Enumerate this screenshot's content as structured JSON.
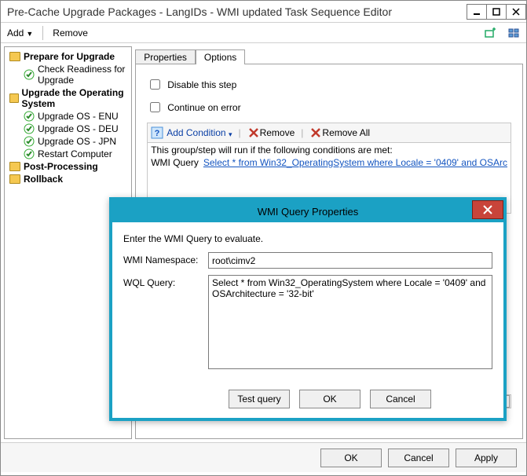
{
  "window": {
    "title": "Pre-Cache Upgrade Packages - LangIDs - WMI updated Task Sequence Editor"
  },
  "toolbar": {
    "add": "Add",
    "remove": "Remove"
  },
  "tree": {
    "g1": "Prepare for Upgrade",
    "g1a": "Check Readiness for Upgrade",
    "g2": "Upgrade the Operating System",
    "g2a": "Upgrade OS - ENU",
    "g2b": "Upgrade OS - DEU",
    "g2c": "Upgrade OS - JPN",
    "g2d": "Restart Computer",
    "g3": "Post-Processing",
    "g4": "Rollback"
  },
  "tabs": {
    "properties": "Properties",
    "options": "Options"
  },
  "options": {
    "disable": "Disable this step",
    "continue": "Continue on error",
    "addcond": "Add Condition",
    "remove": "Remove",
    "removeall": "Remove All",
    "condmsg": "This group/step will run if the following conditions are met:",
    "qlabel": "WMI Query",
    "qtext": "Select * from Win32_OperatingSystem where Locale = '0409' and OSArc"
  },
  "buttons": {
    "ok": "OK",
    "cancel": "Cancel",
    "apply": "Apply"
  },
  "dialog": {
    "title": "WMI Query Properties",
    "intro": "Enter the WMI Query to evaluate.",
    "nslabel": "WMI Namespace:",
    "nsvalue": "root\\cimv2",
    "wqllabel": "WQL Query:",
    "wqlvalue": "Select * from Win32_OperatingSystem where Locale = '0409' and OSArchitecture = '32-bit'",
    "test": "Test query",
    "ok": "OK",
    "cancel": "Cancel"
  }
}
